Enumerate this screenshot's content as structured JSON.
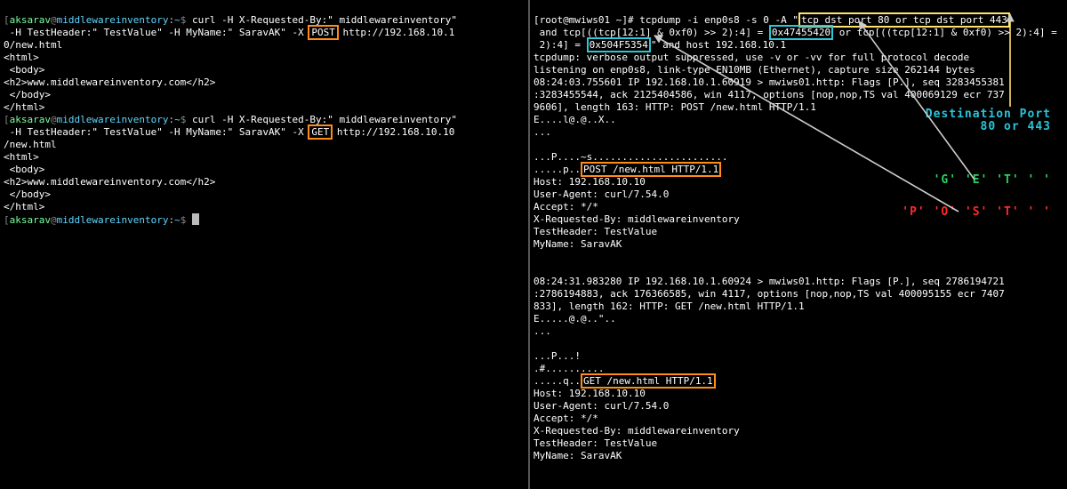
{
  "left": {
    "prompt": {
      "open": "[",
      "user": "aksarav",
      "at": "@",
      "host": "middlewareinventory",
      "colon": ":",
      "path": "~",
      "close": "$ "
    },
    "cmd1": {
      "pre": "curl -H X-Requested-By:\" middlewareinventory\"",
      "line2a": " -H TestHeader:\" TestValue\" -H MyName:\" SaravAK\" -X ",
      "method": "POST",
      "line2b": " http://192.168.10.1",
      "line3": "0/new.html"
    },
    "html1": "<html>\n <body>\n<h2>www.middlewareinventory.com</h2>\n </body>\n</html>",
    "cmd2": {
      "pre": "curl -H X-Requested-By:\" middlewareinventory\"",
      "line2a": " -H TestHeader:\" TestValue\" -H MyName:\" SaravAK\" -X ",
      "method": "GET",
      "line2b": " http://192.168.10.10",
      "line3": "/new.html"
    },
    "html2": "<html>\n <body>\n<h2>www.middlewareinventory.com</h2>\n </body>\n</html>"
  },
  "right": {
    "prompt_full": "[root@mwiws01 ~]# ",
    "cmd": {
      "a": "tcpdump -i enp0s8 -s 0 -A ",
      "q": "\"",
      "f1": "tcp dst port 80 or tcp dst port 443",
      "b": " and tcp[((tcp[12:1] & 0xf0) >> 2):4] = ",
      "hex_get": "0x47455420",
      "c": " or tcp[((tcp[12:1] & 0xf0) >> 2):4] = ",
      "hex_post": "0x504F5354",
      "d": " and host 192.168.10.1"
    },
    "out1": "tcpdump: verbose output suppressed, use -v or -vv for full protocol decode\nlistening on enp0s8, link-type EN10MB (Ethernet), capture size 262144 bytes\n08:24:03.755601 IP 192.168.10.1.60919 > mwiws01.http: Flags [P.], seq 3283455381\n:3283455544, ack 2125404586, win 4117, options [nop,nop,TS val 400069129 ecr 737\n9606], length 163: HTTP: POST /new.html HTTP/1.1\nE....l@.@..X..\n...",
    "pkt1": {
      "a": "...P....~s.......................",
      "b": ".....p..",
      "req": "POST /new.html HTTP/1.1",
      "headers": "Host: 192.168.10.10\nUser-Agent: curl/7.54.0\nAccept: */*\nX-Requested-By: middlewareinventory\nTestHeader: TestValue\nMyName: SaravAK"
    },
    "out2": "08:24:31.983280 IP 192.168.10.1.60924 > mwiws01.http: Flags [P.], seq 2786194721\n:2786194883, ack 176366585, win 4117, options [nop,nop,TS val 400095155 ecr 7407\n833], length 162: HTTP: GET /new.html HTTP/1.1\nE.....@.@..\"..\n...",
    "pkt2": {
      "a": "...P...!",
      "b": ".#..........",
      "c": ".....q..",
      "req": "GET /new.html HTTP/1.1",
      "headers": "Host: 192.168.10.10\nUser-Agent: curl/7.54.0\nAccept: */*\nX-Requested-By: middlewareinventory\nTestHeader: TestValue\nMyName: SaravAK"
    },
    "ann": {
      "dest": "Destination Port\n80 or 443",
      "get": "'G' 'E' 'T' ' '",
      "post": "'P' 'O' 'S' 'T' ' '"
    }
  }
}
